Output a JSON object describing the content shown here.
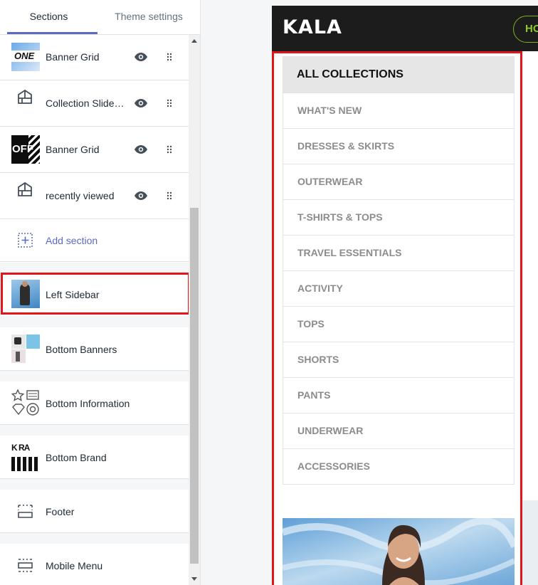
{
  "tabs": [
    {
      "label": "Sections",
      "active": true
    },
    {
      "label": "Theme settings",
      "active": false
    }
  ],
  "sections": {
    "item_banner_grid_1": {
      "label": "Banner Grid",
      "thumb_text": "ONE"
    },
    "item_collection_slider": {
      "label": "Collection Slider..."
    },
    "item_banner_grid_2": {
      "label": "Banner Grid",
      "thumb_text": "OFF"
    },
    "item_recently_viewed": {
      "label": "recently viewed"
    },
    "add_section": {
      "label": "Add section"
    },
    "item_left_sidebar": {
      "label": "Left Sidebar"
    },
    "item_bottom_banners": {
      "label": "Bottom Banners"
    },
    "item_bottom_information": {
      "label": "Bottom Information"
    },
    "item_bottom_brand": {
      "label": "Bottom Brand",
      "thumb_text": "K RA"
    },
    "item_footer": {
      "label": "Footer"
    },
    "item_mobile_menu": {
      "label": "Mobile Menu"
    }
  },
  "preview": {
    "logo": "KALA",
    "nav_button": "HO",
    "collections_title": "ALL COLLECTIONS",
    "collections": [
      "WHAT'S NEW",
      "DRESSES & SKIRTS",
      "OUTERWEAR",
      "T-SHIRTS & TOPS",
      "TRAVEL ESSENTIALS",
      "ACTIVITY",
      "TOPS",
      "SHORTS",
      "PANTS",
      "UNDERWEAR",
      "ACCESSORIES"
    ]
  },
  "colors": {
    "accent": "#5c6ac4",
    "selection_border": "#e0161b",
    "topbar": "#1c1c1c",
    "nav_button_green": "#8ac926"
  },
  "icons": [
    "eye-icon",
    "drag-handle-icon",
    "section-template-icon",
    "add-section-icon",
    "footer-icon",
    "mobile-menu-icon"
  ]
}
